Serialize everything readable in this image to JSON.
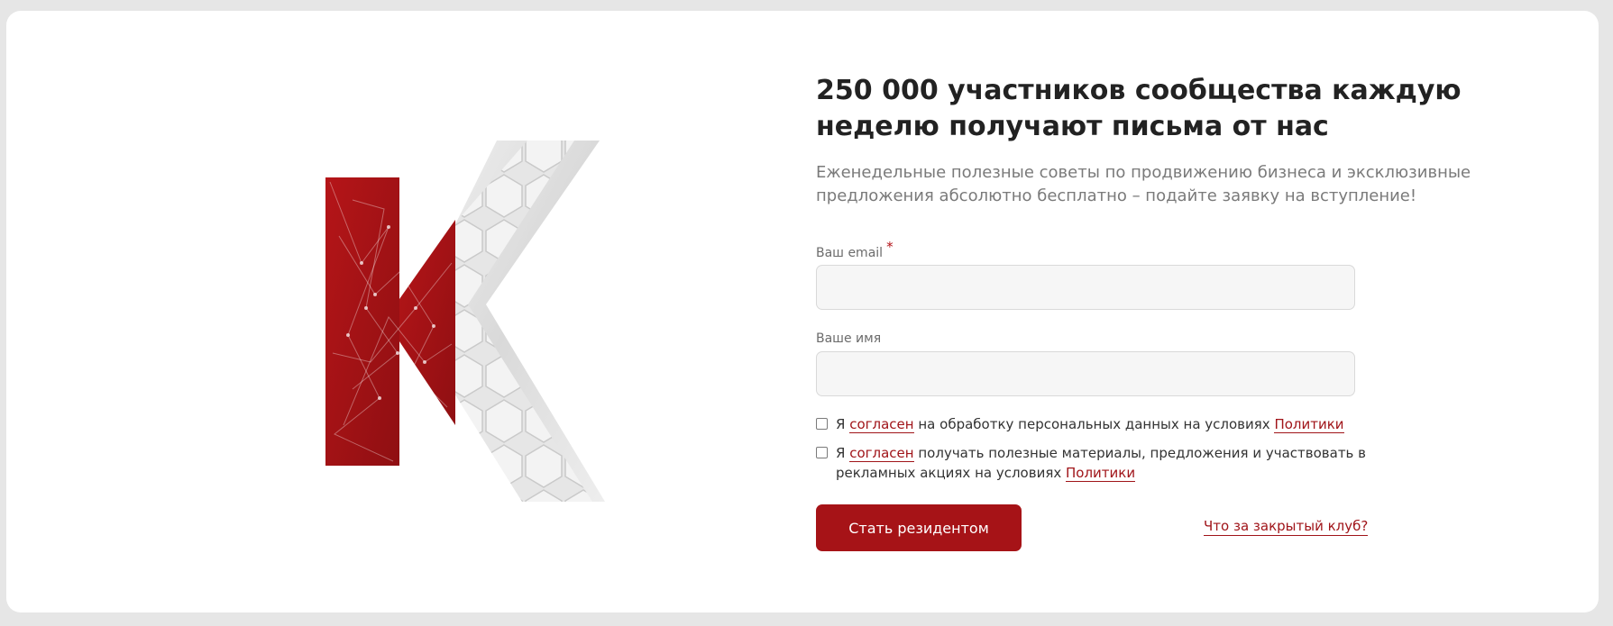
{
  "hero": {
    "title": "250 000 участников сообщества каждую неделю получают письма от нас",
    "subtitle": "Еженедельные полезные советы по продвижению бизнеса и эксклюзивные предложения абсолютно бесплатно – подайте заявку на вступление!"
  },
  "form": {
    "email": {
      "label": "Ваш email",
      "required_mark": "*",
      "value": "",
      "placeholder": ""
    },
    "name": {
      "label": "Ваше имя",
      "value": "",
      "placeholder": ""
    },
    "consent_personal": {
      "checked": false,
      "prefix": "Я",
      "link1": "согласен",
      "middle": "на обработку персональных данных на условиях",
      "link2": "Политики"
    },
    "consent_marketing": {
      "checked": false,
      "prefix": "Я",
      "link1": "согласен",
      "middle": "получать полезные материалы, предложения и участвовать в рекламных акциях на условиях",
      "link2": "Политики"
    },
    "submit_label": "Стать резидентом",
    "club_link": "Что за закрытый клуб?"
  },
  "colors": {
    "brand_red": "#a61317",
    "link_red": "#a01419",
    "page_bg": "#e6e6e6",
    "card_bg": "#ffffff"
  },
  "icons": {
    "logo": "k-logo"
  }
}
